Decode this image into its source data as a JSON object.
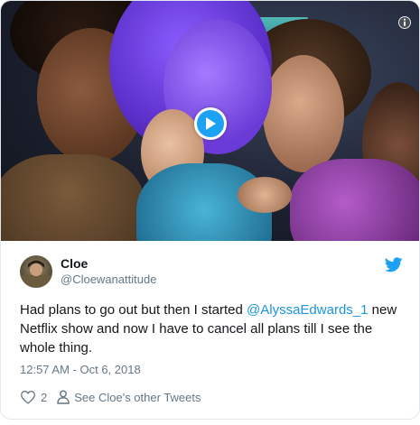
{
  "media": {
    "play_icon": "play-icon",
    "info_icon": "info-icon"
  },
  "author": {
    "display_name": "Cloe",
    "handle": "@Cloewanattitude"
  },
  "tweet": {
    "text_before": "Had plans to go out but then I started ",
    "mention": "@AlyssaEdwards_1",
    "text_after": " new Netflix show and now I have to cancel all plans till I see the whole thing.",
    "timestamp": "12:57 AM - Oct 6, 2018"
  },
  "actions": {
    "like_count": "2",
    "see_more_label": "See Cloe's other Tweets"
  },
  "colors": {
    "twitter_blue": "#1da1f2",
    "link": "#1b95e0",
    "muted": "#657786"
  }
}
